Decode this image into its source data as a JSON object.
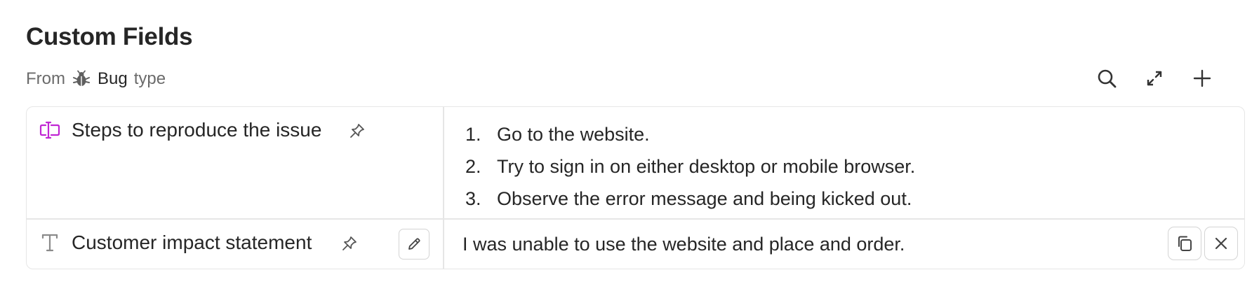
{
  "section": {
    "title": "Custom Fields",
    "from_label": "From",
    "type_name": "Bug",
    "type_suffix": "type"
  },
  "toolbar": {
    "search_icon": "search-icon",
    "expand_icon": "expand-icon",
    "add_icon": "plus-icon"
  },
  "fields": [
    {
      "label": "Steps to reproduce the issue",
      "icon": "text-cursor-icon",
      "icon_color": "#c026d3",
      "steps": [
        {
          "num": "1.",
          "text": "Go to the website."
        },
        {
          "num": "2.",
          "text": "Try to sign in on either desktop or mobile browser."
        },
        {
          "num": "3.",
          "text": "Observe the error message and being kicked out."
        }
      ]
    },
    {
      "label": "Customer impact statement",
      "icon": "text-type-icon",
      "icon_color": "#8a8a8a",
      "value": "I was unable to use the website and place and order."
    }
  ],
  "colors": {
    "border": "#e6e6e6",
    "text": "#262626",
    "muted": "#6b6b6b",
    "accent": "#c026d3"
  }
}
